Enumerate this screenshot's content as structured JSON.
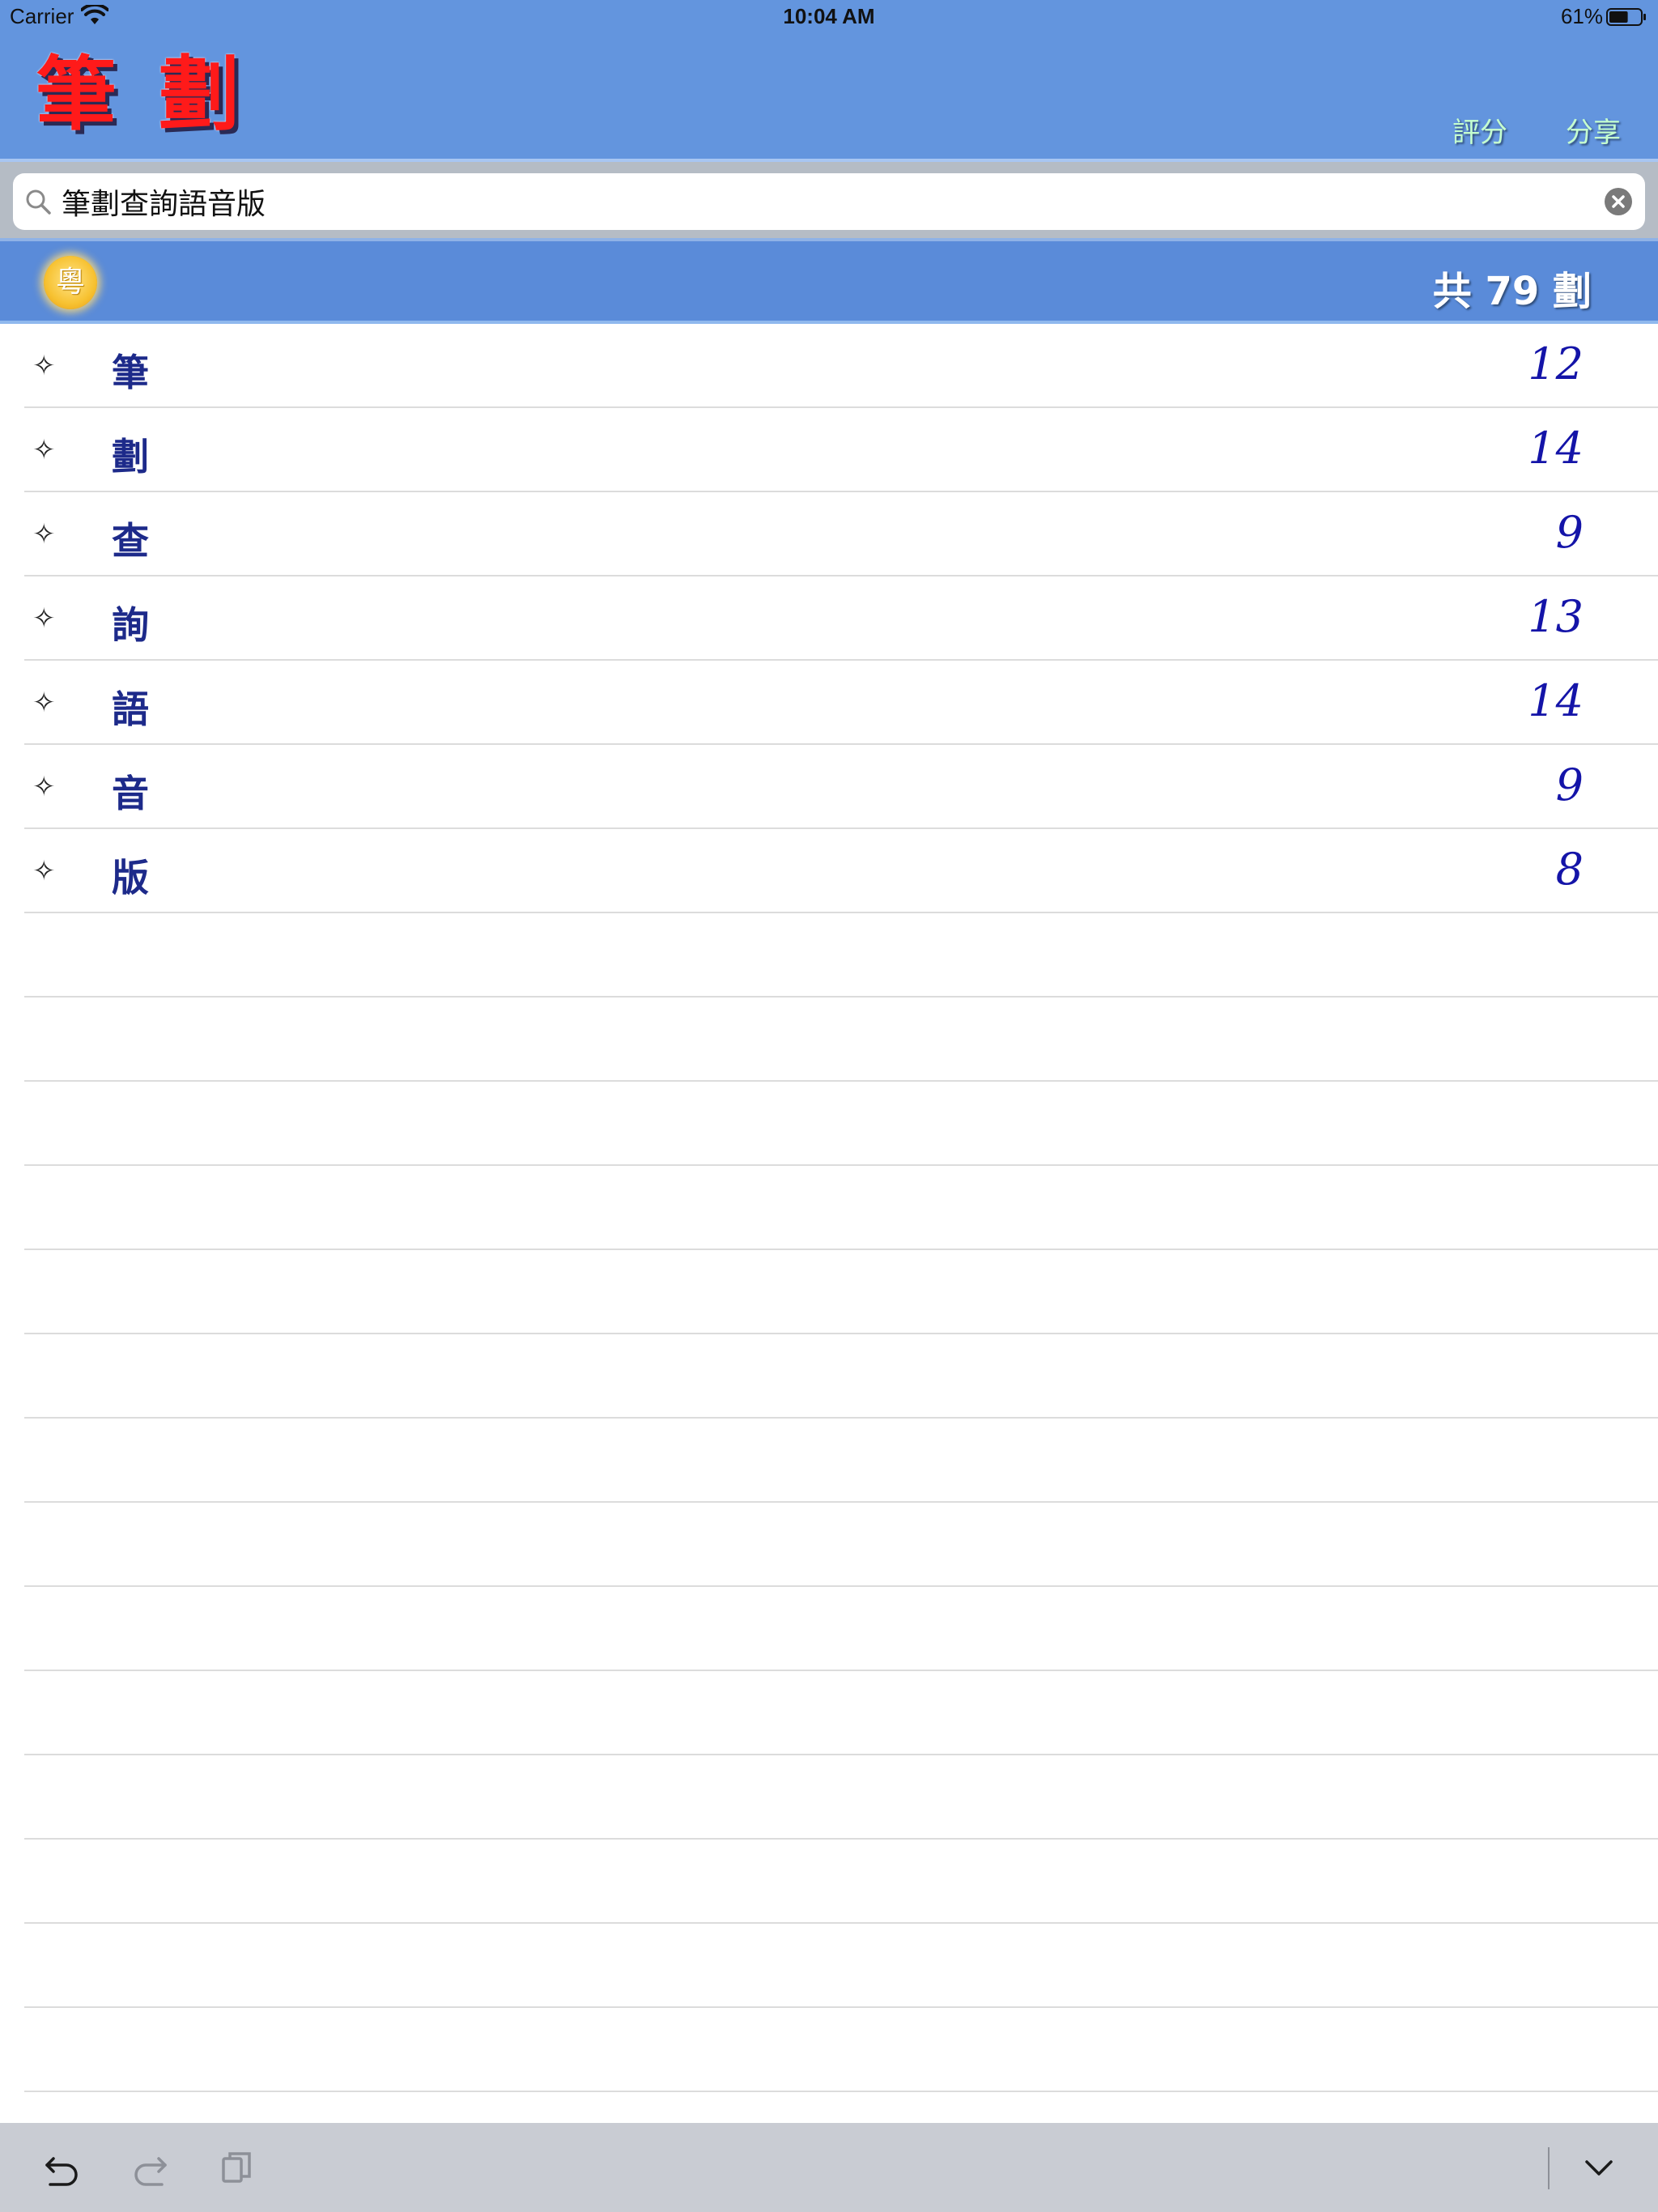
{
  "status_bar": {
    "carrier": "Carrier",
    "time": "10:04 AM",
    "battery": "61%",
    "battery_level": 0.61
  },
  "header": {
    "title": "筆劃",
    "rate_label": "評分",
    "share_label": "分享"
  },
  "search": {
    "value": "筆劃查詢語音版"
  },
  "info_bar": {
    "badge": "粵",
    "total": "共 79 劃"
  },
  "list": {
    "marker": "✧",
    "items": [
      {
        "char": "筆",
        "strokes": "12"
      },
      {
        "char": "劃",
        "strokes": "14"
      },
      {
        "char": "查",
        "strokes": "9"
      },
      {
        "char": "詢",
        "strokes": "13"
      },
      {
        "char": "語",
        "strokes": "14"
      },
      {
        "char": "音",
        "strokes": "9"
      },
      {
        "char": "版",
        "strokes": "8"
      }
    ]
  },
  "colors": {
    "header_bg": "#6395de",
    "title": "#ff1a1a",
    "char_text": "#1d2a8a",
    "stroke_text": "#1414a8",
    "info_bar_bg": "#5a8bd9"
  },
  "icons": {
    "wifi": "wifi-icon",
    "battery": "battery-icon",
    "search": "search-icon",
    "clear": "clear-icon",
    "undo": "undo-icon",
    "redo": "redo-icon",
    "paste": "paste-icon",
    "dismiss_keyboard": "chevron-down-icon"
  }
}
